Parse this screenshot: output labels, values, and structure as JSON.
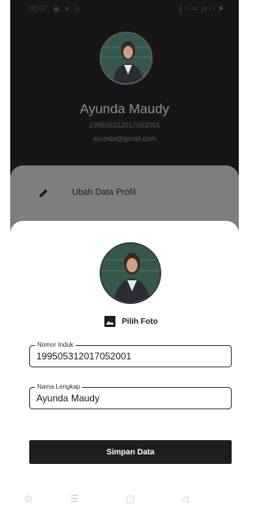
{
  "status_bar": {
    "time": "00:07",
    "left_icons": [
      "image-icon",
      "twitter-icon",
      "messenger-icon"
    ],
    "right_text": "∦ ⁵⁶ ≋ .ıll ⁹⁶"
  },
  "profile": {
    "name": "Ayunda Maudy",
    "nomor_induk": "199505312017052001",
    "email": "ayunda@gmail.com"
  },
  "menu": {
    "items": [
      {
        "icon": "pencil-icon",
        "label": "Ubah Data Profil"
      }
    ]
  },
  "form": {
    "pick_photo_label": "Pilih Foto",
    "nomor_induk": {
      "label": "Nomor Induk",
      "value": "199505312017052001"
    },
    "nama_lengkap": {
      "label": "Nama Lengkap",
      "value": "Ayunda Maudy"
    },
    "save_label": "Simpan Data"
  },
  "nav_bar": {
    "buttons": [
      {
        "icon": "assistant-icon",
        "glyph": "⊙"
      },
      {
        "icon": "menu-icon",
        "glyph": "☰"
      },
      {
        "icon": "home-icon",
        "glyph": "▢"
      },
      {
        "icon": "back-icon",
        "glyph": "◁"
      }
    ]
  },
  "colors": {
    "background_dark": "#161616",
    "menu_sheet": "#7e7e7e",
    "primary_button": "#1e1e1e",
    "charging": "#3cbf5a"
  }
}
